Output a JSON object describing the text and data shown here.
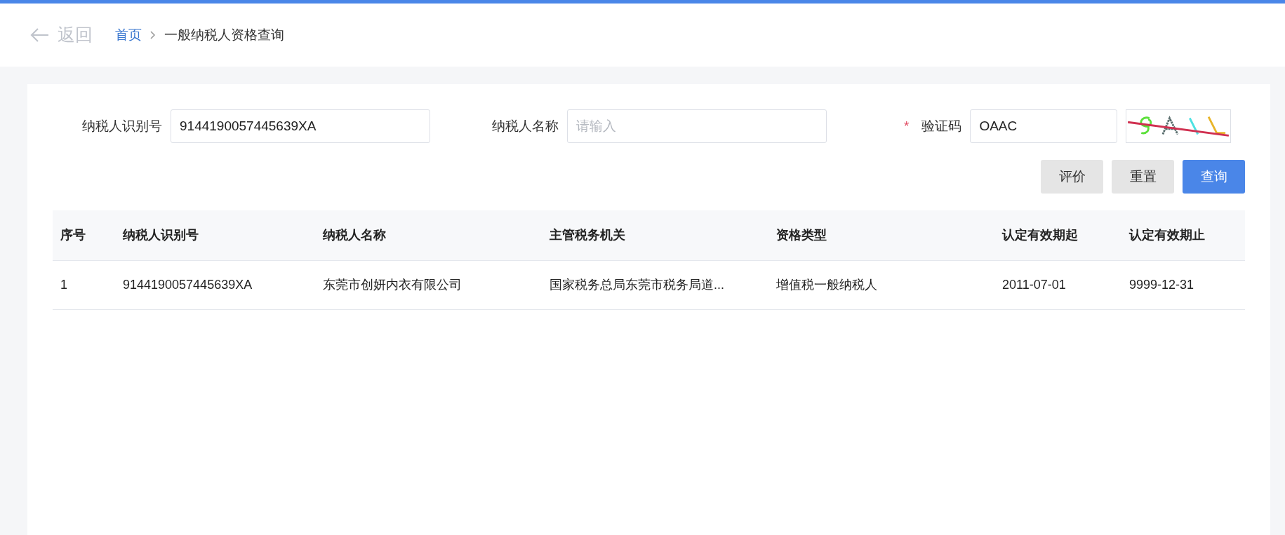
{
  "header": {
    "back_label": "返回",
    "breadcrumb": [
      {
        "label": "首页",
        "link": true
      },
      {
        "label": "一般纳税人资格查询",
        "link": false
      }
    ]
  },
  "form": {
    "fields": [
      {
        "label": "纳税人识别号",
        "value": "9144190057445639XA"
      },
      {
        "label": "纳税人名称",
        "placeholder": "请输入"
      },
      {
        "label": "验证码",
        "value": "OAAC",
        "required_mark": "*",
        "kind": "captcha"
      }
    ],
    "buttons": [
      {
        "label": "评价",
        "primary": false
      },
      {
        "label": "重置",
        "primary": false
      },
      {
        "label": "查询",
        "primary": true
      }
    ]
  },
  "table": {
    "columns": [
      "序号",
      "纳税人识别号",
      "纳税人名称",
      "主管税务机关",
      "资格类型",
      "认定有效期起",
      "认定有效期止"
    ],
    "rows": [
      [
        "1",
        "9144190057445639XA",
        "东莞市创妍内衣有限公司",
        "国家税务总局东莞市税务局道...",
        "增值税一般纳税人",
        "2011-07-01",
        "9999-12-31"
      ]
    ]
  }
}
